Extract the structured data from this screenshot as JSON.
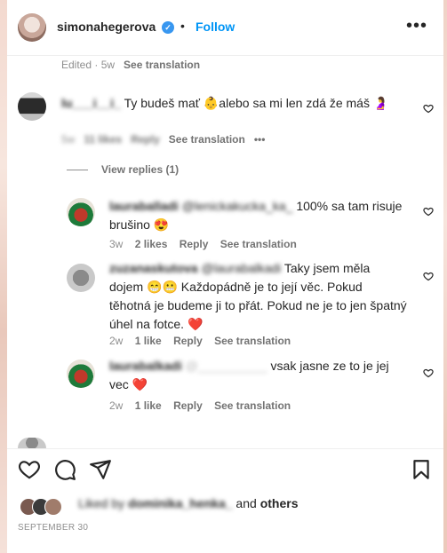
{
  "header": {
    "username": "simonahegerova",
    "verified_glyph": "✓",
    "separator": "•",
    "follow_label": "Follow",
    "more_label": "•••"
  },
  "caption_meta": {
    "edited": "Edited · 5w",
    "see_translation": "See translation"
  },
  "comments": [
    {
      "username": "lu___i__i_",
      "text": "Ty budeš mať 👶alebo sa mi len zdá že máš 🤰",
      "time": "5w",
      "likes": "11 likes",
      "reply": "Reply",
      "see_translation": "See translation",
      "more": "•••",
      "view_replies": "View replies (1)"
    }
  ],
  "replies": [
    {
      "username": "lauraballadi",
      "mention": "@lenickakucka_ka_",
      "text": " 100% sa tam risuje brušino 😍",
      "time": "3w",
      "likes": "2 likes",
      "reply": "Reply",
      "see_translation": "See translation"
    },
    {
      "username": "zuzanaskutova",
      "mention": "@laurabalkadi",
      "text": " Taky jsem měla dojem 😁😬 Každopádně je to její věc. Pokud těhotná je budeme ji to přát. Pokud ne je to jen špatný úhel na fotce. ❤️",
      "time": "2w",
      "likes": "1 like",
      "reply": "Reply",
      "see_translation": "See translation"
    },
    {
      "username": "laurabalkadi",
      "mention": "@__________",
      "text": " vsak jasne ze to je jej vec ❤️",
      "time": "2w",
      "likes": "1 like",
      "reply": "Reply",
      "see_translation": "See translation"
    }
  ],
  "liked": {
    "prefix": "Liked by ",
    "user": "dominika_henka_",
    "and": " and ",
    "others": "others"
  },
  "date": "SEPTEMBER 30",
  "icons": {
    "like": "heart-icon",
    "comment": "comment-icon",
    "share": "share-icon",
    "save": "bookmark-icon",
    "more": "more-icon"
  },
  "colors": {
    "accent": "#0095f6",
    "text": "#262626",
    "secondary": "#8e8e8e",
    "heart_red": "#ed4956"
  }
}
